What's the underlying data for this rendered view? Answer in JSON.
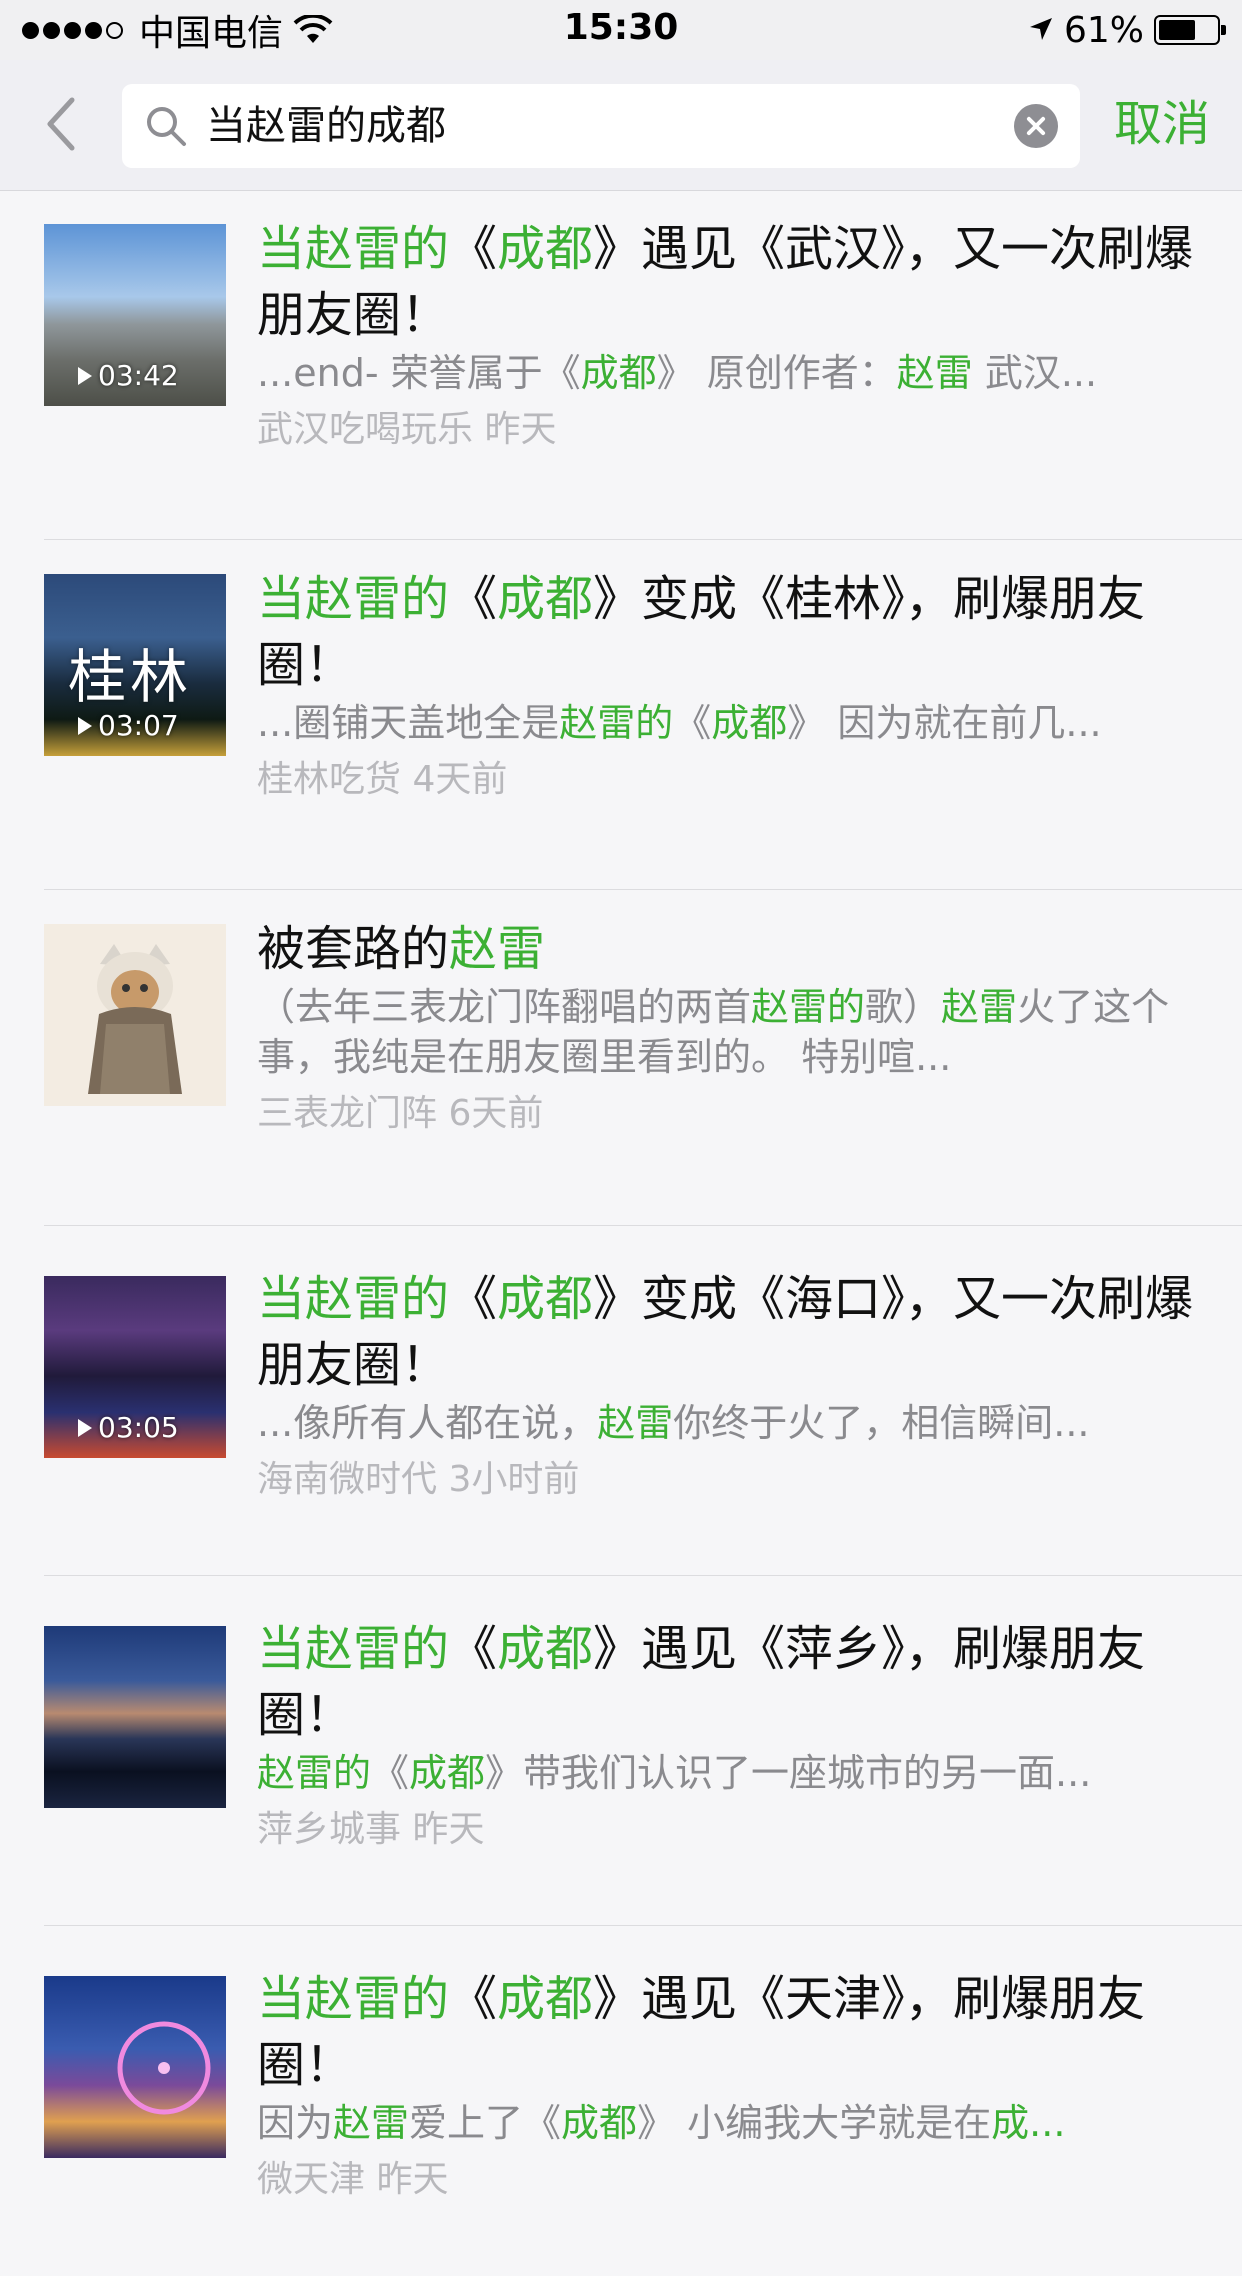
{
  "status_bar": {
    "carrier": "中国电信",
    "time": "15:30",
    "battery": "61%"
  },
  "search": {
    "query": "当赵雷的成都",
    "cancel_label": "取消"
  },
  "colors": {
    "highlight": "#3cb034",
    "meta": "#b8b8bc",
    "snippet": "#8a8a8e"
  },
  "results": [
    {
      "duration": "03:42",
      "title": [
        [
          "当赵雷的",
          true
        ],
        [
          "《",
          false
        ],
        [
          "成都",
          true
        ],
        [
          "》遇见《武汉》，又一次刷爆朋友圈！",
          false
        ]
      ],
      "snippet": [
        [
          "...end- 荣誉属于《",
          false
        ],
        [
          "成都",
          true
        ],
        [
          "》 原创作者：",
          false
        ],
        [
          "赵雷",
          true
        ],
        [
          " 武汉...",
          false
        ]
      ],
      "source": "武汉吃喝玩乐",
      "time": "昨天"
    },
    {
      "duration": "03:07",
      "thumb_text": "桂林",
      "title": [
        [
          "当赵雷的",
          true
        ],
        [
          "《",
          false
        ],
        [
          "成都",
          true
        ],
        [
          "》变成《桂林》，刷爆朋友圈！",
          false
        ]
      ],
      "snippet": [
        [
          "...圈铺天盖地全是",
          false
        ],
        [
          "赵雷的",
          true
        ],
        [
          "《",
          false
        ],
        [
          "成都",
          true
        ],
        [
          "》 因为就在前几...",
          false
        ]
      ],
      "source": "桂林吃货",
      "time": "4天前"
    },
    {
      "title": [
        [
          "被套路的",
          false
        ],
        [
          "赵雷",
          true
        ]
      ],
      "snippet": [
        [
          "（去年三表龙门阵翻唱的两首",
          false
        ],
        [
          "赵雷的",
          true
        ],
        [
          "歌）",
          false
        ],
        [
          "赵雷",
          true
        ],
        [
          "火了这个事，我纯是在朋友圈里看到的。 特别喧...",
          false
        ]
      ],
      "source": "三表龙门阵",
      "time": "6天前"
    },
    {
      "duration": "03:05",
      "title": [
        [
          "当赵雷的",
          true
        ],
        [
          "《",
          false
        ],
        [
          "成都",
          true
        ],
        [
          "》变成《海口》，又一次刷爆朋友圈！",
          false
        ]
      ],
      "snippet": [
        [
          "...像所有人都在说，",
          false
        ],
        [
          "赵雷",
          true
        ],
        [
          "你终于火了，相信瞬间...",
          false
        ]
      ],
      "source": "海南微时代",
      "time": "3小时前"
    },
    {
      "title": [
        [
          "当赵雷的",
          true
        ],
        [
          "《",
          false
        ],
        [
          "成都",
          true
        ],
        [
          "》遇见《萍乡》，刷爆朋友圈！",
          false
        ]
      ],
      "snippet": [
        [
          "赵雷的",
          true
        ],
        [
          "《",
          false
        ],
        [
          "成都",
          true
        ],
        [
          "》带我们认识了一座城市的另一面...",
          false
        ]
      ],
      "source": "萍乡城事",
      "time": "昨天"
    },
    {
      "title": [
        [
          "当赵雷的",
          true
        ],
        [
          "《",
          false
        ],
        [
          "成都",
          true
        ],
        [
          "》遇见《天津》，刷爆朋友圈！",
          false
        ]
      ],
      "snippet": [
        [
          "因为",
          false
        ],
        [
          "赵雷",
          true
        ],
        [
          "爱上了《",
          false
        ],
        [
          "成都",
          true
        ],
        [
          "》 小编我大学就是在",
          false
        ],
        [
          "成...",
          true
        ]
      ],
      "source": "微天津",
      "time": "昨天"
    }
  ]
}
